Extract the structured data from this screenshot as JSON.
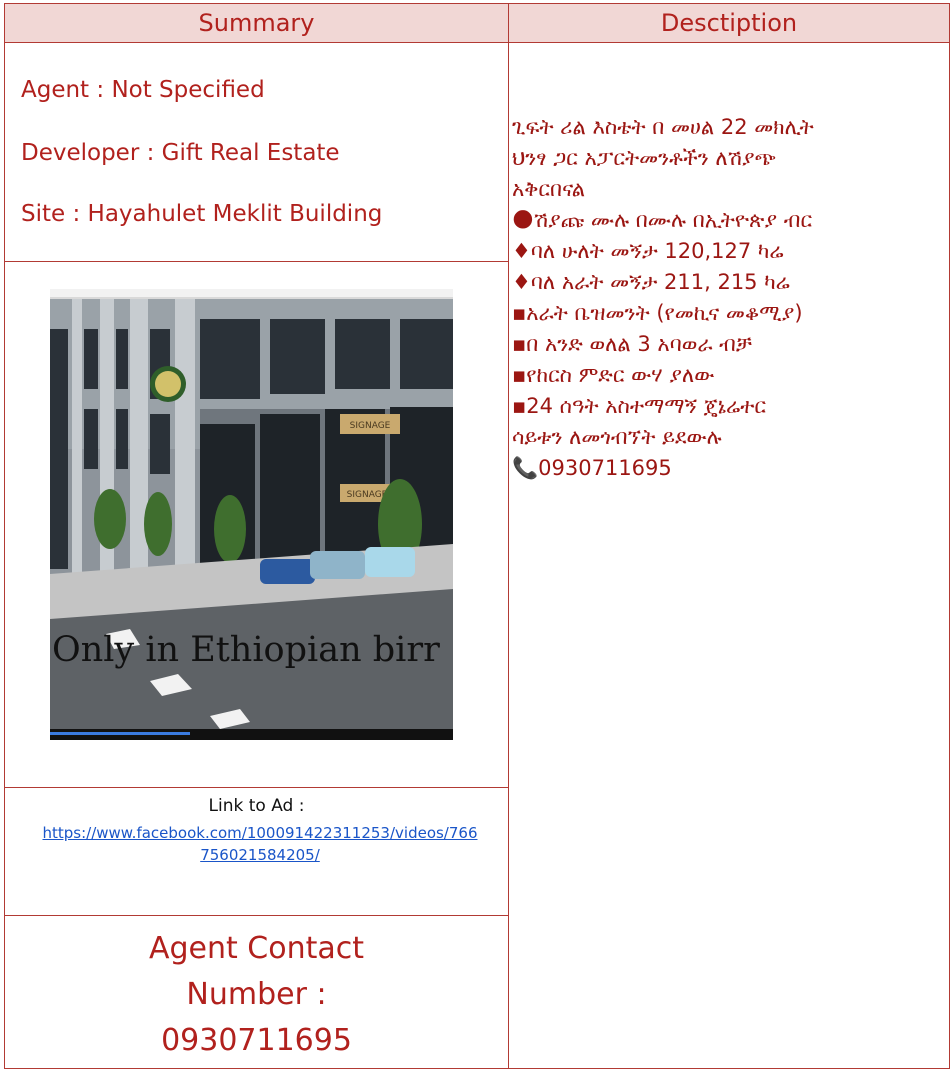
{
  "headers": {
    "summary": "Summary",
    "description": "Desctiption"
  },
  "summary": {
    "agent": "Agent : Not Specified",
    "developer": "Developer : Gift Real Estate",
    "site": "Site : Hayahulet Meklit Building"
  },
  "image": {
    "overlay_text": "Only in Ethiopian birr",
    "signage_1": "SIGNAGE",
    "signage_2": "SIGNAGE"
  },
  "link": {
    "label": "Link to Ad :",
    "url": "https://www.facebook.com/100091422311253/videos/766756021584205/"
  },
  "contact": {
    "line1": "Agent Contact",
    "line2": "Number :",
    "line3": "0930711695"
  },
  "description": {
    "lines": [
      "ጊፍት ሪል እስቴት በ መሀል 22 መክሊት",
      "ህንፃ ጋር አፓርትመንቶችን ለሽያጭ",
      "አቅርበናል",
      "🌑ሽያጩ ሙሉ በሙሉ በኢትዮጵያ ብር",
      "♦ባለ ሁለት መኝታ 120,127 ካሬ",
      "♦ባለ አራት መኝታ 211, 215 ካሬ",
      "▪︎አራት ቤዝመንት (የመኪና መቆሚያ)",
      "▪︎በ አንድ ወለል 3 አባወራ ብቻ",
      "▪︎የከርስ ምድር ውሃ ያለው",
      "▪︎24 ሰዓት አስተማማኝ ጄኔሬተር",
      "ሳይቱን ለመጎብኘት ይደውሉ",
      "📞0930711695"
    ]
  }
}
